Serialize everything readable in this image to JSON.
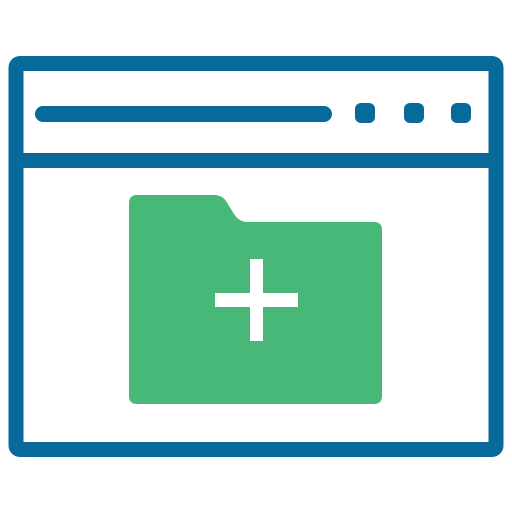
{
  "icon": {
    "name": "new-folder-in-browser-window",
    "colors": {
      "frame": "#08699B",
      "folder": "#48B879",
      "plus": "#FFFFFF",
      "background": "#FFFFFF"
    },
    "window_controls": [
      "dot",
      "dot",
      "dot"
    ]
  }
}
